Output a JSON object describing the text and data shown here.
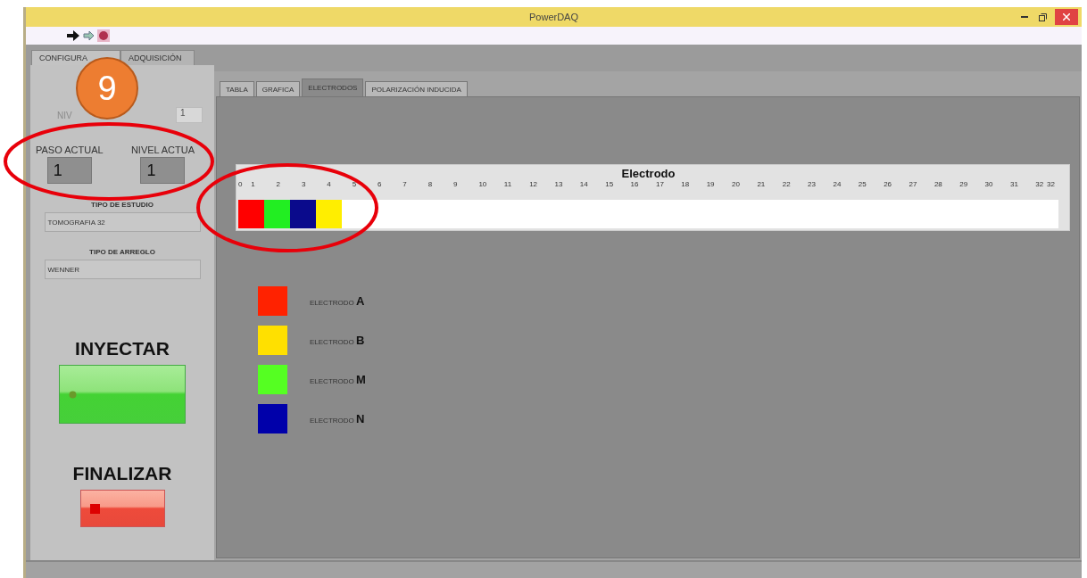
{
  "window": {
    "title": "PowerDAQ"
  },
  "main_tabs": [
    {
      "label": "CONFIGURA",
      "selected": true
    },
    {
      "label": "ADQUISICIÓN",
      "selected": false
    }
  ],
  "config": {
    "nivel": {
      "label": "NIV",
      "value": "1"
    },
    "paso_actual": {
      "label": "PASO ACTUAL",
      "value": "1"
    },
    "nivel_actual": {
      "label": "NIVEL ACTUA",
      "value": "1"
    },
    "study_type": {
      "label": "TIPO DE ESTUDIO",
      "value": "TOMOGRAFIA 32"
    },
    "array_type": {
      "label": "TIPO DE ARREGLO",
      "value": "WENNER"
    }
  },
  "inject": {
    "label": "INYECTAR"
  },
  "finish": {
    "label": "FINALIZAR"
  },
  "view_tabs": [
    {
      "label": "TABLA",
      "selected": false
    },
    {
      "label": "GRAFICA",
      "selected": false
    },
    {
      "label": "ELECTRODOS",
      "selected": true
    },
    {
      "label": "POLARIZACIÓN INDUCIDA",
      "selected": false
    }
  ],
  "electrode_bar": {
    "title": "Electrodo",
    "ticks": [
      "0",
      "1",
      "2",
      "3",
      "4",
      "5",
      "6",
      "7",
      "8",
      "9",
      "10",
      "11",
      "12",
      "13",
      "14",
      "15",
      "16",
      "17",
      "18",
      "19",
      "20",
      "21",
      "22",
      "23",
      "24",
      "25",
      "26",
      "27",
      "28",
      "29",
      "30",
      "31",
      "32",
      "32"
    ],
    "cells": [
      {
        "color": "#ff0000"
      },
      {
        "color": "#22ee22"
      },
      {
        "color": "#0a0a8c"
      },
      {
        "color": "#ffee00"
      }
    ]
  },
  "legend": [
    {
      "color": "#ff2200",
      "label": "ELECTRODO **A**"
    },
    {
      "color": "#ffe000",
      "label": "ELECTRODO **B**"
    },
    {
      "color": "#55ff22",
      "label": "ELECTRODO **M**"
    },
    {
      "color": "#0000aa",
      "label": "ELECTRODO **N**"
    }
  ],
  "annotation": {
    "badge": "9"
  }
}
